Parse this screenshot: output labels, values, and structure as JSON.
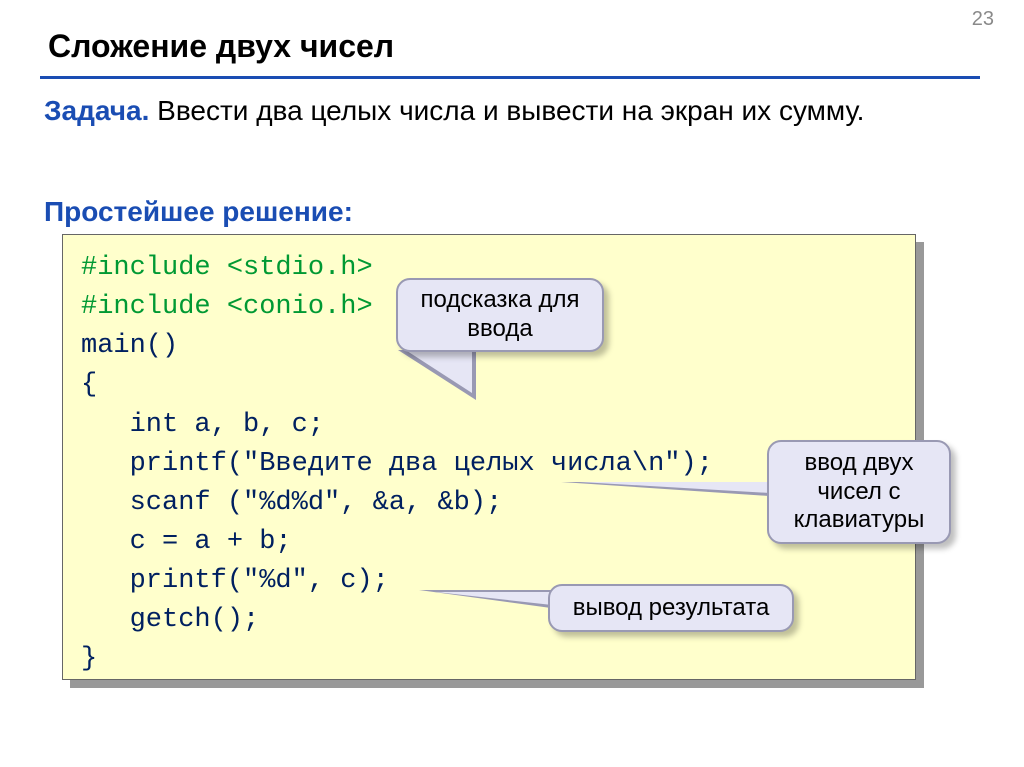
{
  "pageNumber": "23",
  "title": "Сложение двух чисел",
  "taskLabel": "Задача.",
  "taskText": " Ввести два целых числа и вывести на экран их сумму.",
  "solutionLabel": "Простейшее решение:",
  "code": {
    "l1": "#include <stdio.h>",
    "l2": "#include <conio.h>",
    "l3": "main()",
    "l4": "{",
    "l5": "   int a, b, c;",
    "l6": "   printf(\"Введите два целых числа\\n\");",
    "l7": "   scanf (\"%d%d\", &a, &b);",
    "l8": "   c = a + b;",
    "l9": "   printf(\"%d\", c);",
    "l10": "   getch();",
    "l11": "}"
  },
  "callouts": {
    "hint": "подсказка для ввода",
    "input": "ввод двух чисел с клавиатуры",
    "output": "вывод результата"
  }
}
